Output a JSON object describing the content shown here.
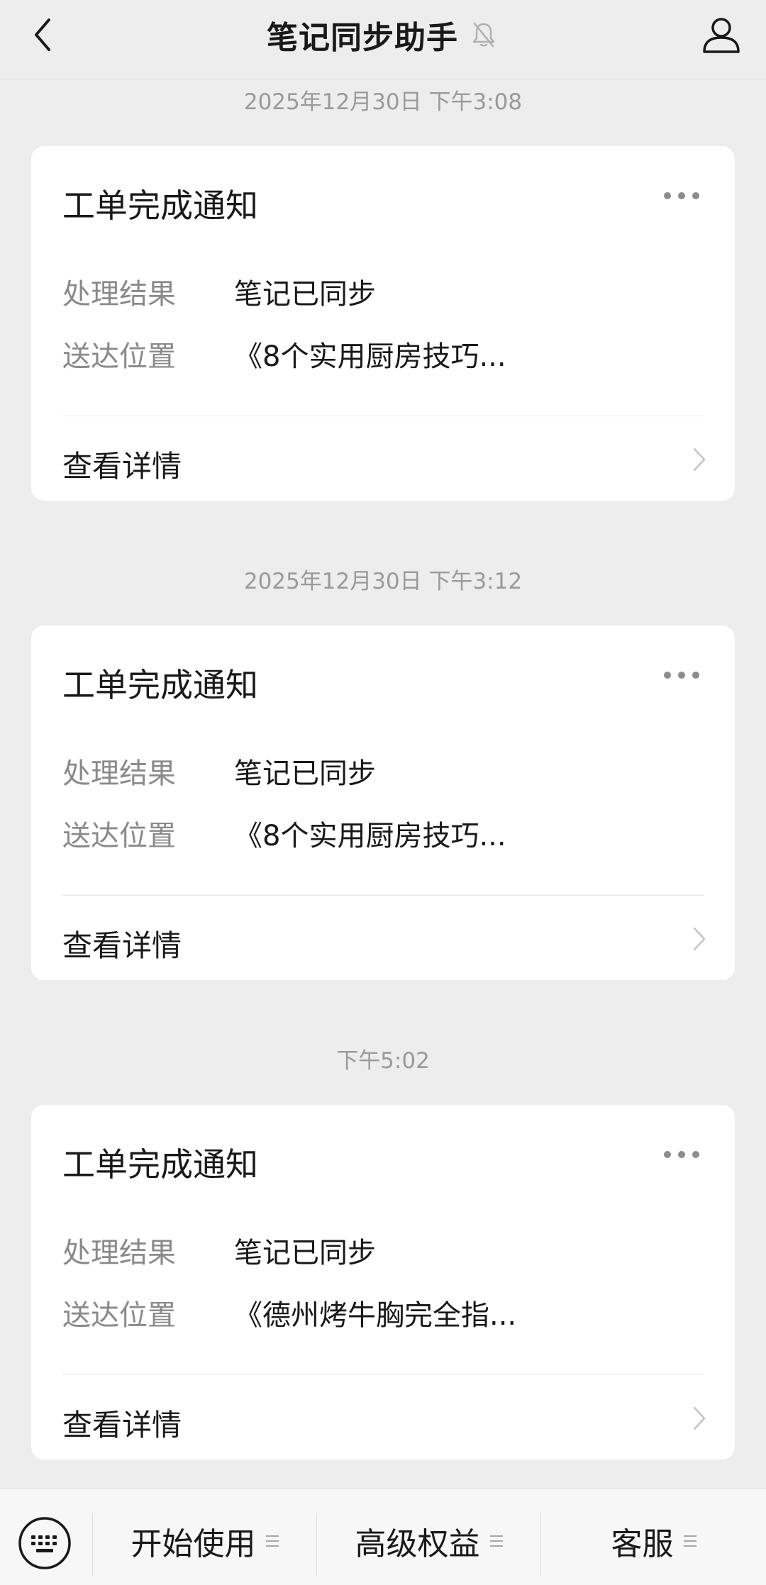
{
  "header": {
    "title": "笔记同步助手",
    "back_icon": "chevron-left-icon",
    "mute_icon": "bell-muted-icon",
    "profile_icon": "user-icon"
  },
  "messages": [
    {
      "timestamp": "2025年12月30日 下午3:08",
      "card_title": "工单完成通知",
      "result_label": "处理结果",
      "result_value": "笔记已同步",
      "location_label": "送达位置",
      "location_value": "《8个实用厨房技巧...",
      "detail_label": "查看详情"
    },
    {
      "timestamp": "2025年12月30日 下午3:12",
      "card_title": "工单完成通知",
      "result_label": "处理结果",
      "result_value": "笔记已同步",
      "location_label": "送达位置",
      "location_value": "《8个实用厨房技巧...",
      "detail_label": "查看详情"
    },
    {
      "timestamp": "下午5:02",
      "card_title": "工单完成通知",
      "result_label": "处理结果",
      "result_value": "笔记已同步",
      "location_label": "送达位置",
      "location_value": "《德州烤牛胸完全指...",
      "detail_label": "查看详情"
    }
  ],
  "bottom_menu": {
    "keyboard_icon": "keyboard-icon",
    "items": [
      {
        "label": "开始使用"
      },
      {
        "label": "高级权益"
      },
      {
        "label": "客服"
      }
    ]
  },
  "colors": {
    "background": "#ededed",
    "card": "#ffffff",
    "secondary_text": "#8a8a8a",
    "timestamp_text": "#9a9a9a"
  }
}
